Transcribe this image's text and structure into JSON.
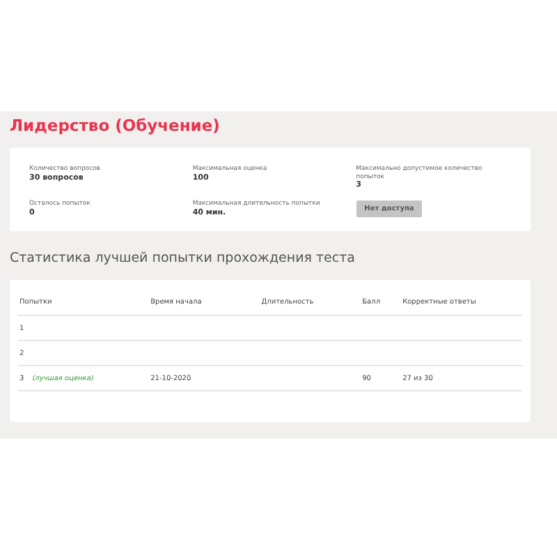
{
  "title": "Лидерство (Обучение)",
  "info": [
    {
      "label": "Количество вопросов",
      "value": "30 вопросов"
    },
    {
      "label": "Максимальная оценка",
      "value": "100"
    },
    {
      "label": "Максимально допустимое количество попыток",
      "value": "3"
    },
    {
      "label": "Осталось попыток",
      "value": "0"
    },
    {
      "label": "Максимальная длительность попытки",
      "value": "40 мин."
    }
  ],
  "access_button": {
    "label": "Нет доступа",
    "disabled": true
  },
  "stats_title": "Статистика лучшей попытки прохождения теста",
  "table": {
    "columns": [
      "Попытки",
      "Время начала",
      "Длительность",
      "Балл",
      "Корректные ответы"
    ],
    "rows": [
      {
        "attempt": "1",
        "note": "",
        "start": "",
        "duration": "",
        "score": "",
        "correct": ""
      },
      {
        "attempt": "2",
        "note": "",
        "start": "",
        "duration": "",
        "score": "",
        "correct": ""
      },
      {
        "attempt": "3",
        "note": "(лучшая оценка)",
        "start": "21-10-2020",
        "duration": "",
        "score": "90",
        "correct": "27 из 30"
      }
    ]
  }
}
